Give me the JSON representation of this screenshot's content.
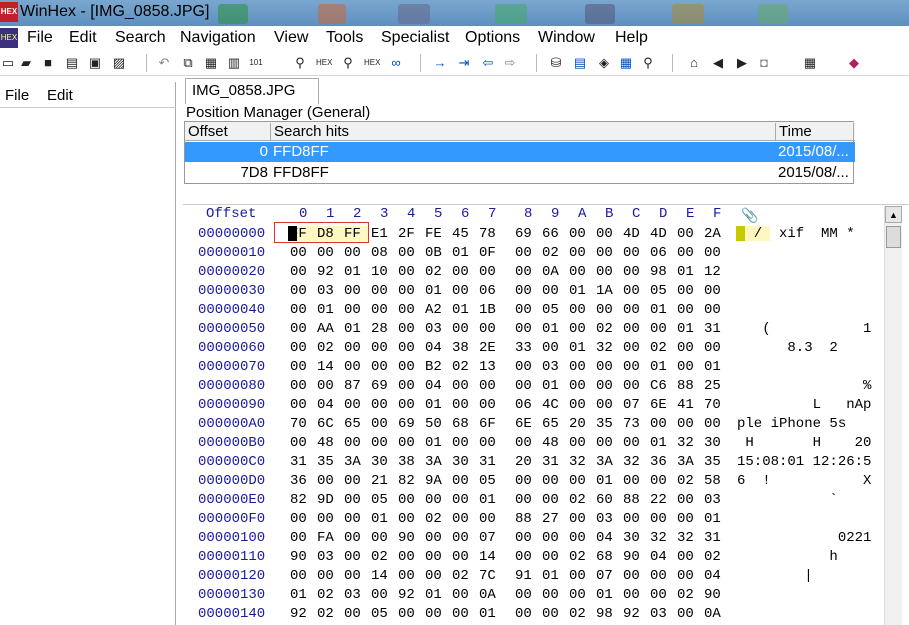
{
  "window": {
    "title": "WinHex - [IMG_0858.JPG]"
  },
  "menu": [
    "File",
    "Edit",
    "Search",
    "Navigation",
    "View",
    "Tools",
    "Specialist",
    "Options",
    "Window",
    "Help"
  ],
  "left_menu": [
    "File",
    "Edit"
  ],
  "tab": {
    "label": "IMG_0858.JPG"
  },
  "position_manager": {
    "title": "Position Manager (General)",
    "columns": [
      "Offset",
      "Search hits",
      "Time"
    ],
    "rows": [
      {
        "offset": "0",
        "hits": "FFD8FF",
        "time": "2015/08/..."
      },
      {
        "offset": "7D8",
        "hits": "FFD8FF",
        "time": "2015/08/..."
      }
    ]
  },
  "hex": {
    "offset_label": "Offset",
    "columns": [
      "0",
      "1",
      "2",
      "3",
      "4",
      "5",
      "6",
      "7",
      "8",
      "9",
      "A",
      "B",
      "C",
      "D",
      "E",
      "F"
    ],
    "rows": [
      {
        "off": "00000000",
        "bytes": [
          "FF",
          "D8",
          "FF",
          "E1",
          "2F",
          "FE",
          "45",
          "78",
          "69",
          "66",
          "00",
          "00",
          "4D",
          "4D",
          "00",
          "2A"
        ],
        "ascii": "  /  xif  MM *"
      },
      {
        "off": "00000010",
        "bytes": [
          "00",
          "00",
          "00",
          "08",
          "00",
          "0B",
          "01",
          "0F",
          "00",
          "02",
          "00",
          "00",
          "00",
          "06",
          "00",
          "00"
        ],
        "ascii": ""
      },
      {
        "off": "00000020",
        "bytes": [
          "00",
          "92",
          "01",
          "10",
          "00",
          "02",
          "00",
          "00",
          "00",
          "0A",
          "00",
          "00",
          "00",
          "98",
          "01",
          "12"
        ],
        "ascii": ""
      },
      {
        "off": "00000030",
        "bytes": [
          "00",
          "03",
          "00",
          "00",
          "00",
          "01",
          "00",
          "06",
          "00",
          "00",
          "01",
          "1A",
          "00",
          "05",
          "00",
          "00"
        ],
        "ascii": ""
      },
      {
        "off": "00000040",
        "bytes": [
          "00",
          "01",
          "00",
          "00",
          "00",
          "A2",
          "01",
          "1B",
          "00",
          "05",
          "00",
          "00",
          "00",
          "01",
          "00",
          "00"
        ],
        "ascii": ""
      },
      {
        "off": "00000050",
        "bytes": [
          "00",
          "AA",
          "01",
          "28",
          "00",
          "03",
          "00",
          "00",
          "00",
          "01",
          "00",
          "02",
          "00",
          "00",
          "01",
          "31"
        ],
        "ascii": "   (           1"
      },
      {
        "off": "00000060",
        "bytes": [
          "00",
          "02",
          "00",
          "00",
          "00",
          "04",
          "38",
          "2E",
          "33",
          "00",
          "01",
          "32",
          "00",
          "02",
          "00",
          "00"
        ],
        "ascii": "      8.3  2"
      },
      {
        "off": "00000070",
        "bytes": [
          "00",
          "14",
          "00",
          "00",
          "00",
          "B2",
          "02",
          "13",
          "00",
          "03",
          "00",
          "00",
          "00",
          "01",
          "00",
          "01"
        ],
        "ascii": ""
      },
      {
        "off": "00000080",
        "bytes": [
          "00",
          "00",
          "87",
          "69",
          "00",
          "04",
          "00",
          "00",
          "00",
          "01",
          "00",
          "00",
          "00",
          "C6",
          "88",
          "25"
        ],
        "ascii": "               %"
      },
      {
        "off": "00000090",
        "bytes": [
          "00",
          "04",
          "00",
          "00",
          "00",
          "01",
          "00",
          "00",
          "06",
          "4C",
          "00",
          "00",
          "07",
          "6E",
          "41",
          "70"
        ],
        "ascii": "         L   nAp"
      },
      {
        "off": "000000A0",
        "bytes": [
          "70",
          "6C",
          "65",
          "00",
          "69",
          "50",
          "68",
          "6F",
          "6E",
          "65",
          "20",
          "35",
          "73",
          "00",
          "00",
          "00"
        ],
        "ascii": "ple iPhone 5s"
      },
      {
        "off": "000000B0",
        "bytes": [
          "00",
          "48",
          "00",
          "00",
          "00",
          "01",
          "00",
          "00",
          "00",
          "48",
          "00",
          "00",
          "00",
          "01",
          "32",
          "30"
        ],
        "ascii": " H       H    20"
      },
      {
        "off": "000000C0",
        "bytes": [
          "31",
          "35",
          "3A",
          "30",
          "38",
          "3A",
          "30",
          "31",
          "20",
          "31",
          "32",
          "3A",
          "32",
          "36",
          "3A",
          "35"
        ],
        "ascii": "15:08:01 12:26:5"
      },
      {
        "off": "000000D0",
        "bytes": [
          "36",
          "00",
          "00",
          "21",
          "82",
          "9A",
          "00",
          "05",
          "00",
          "00",
          "00",
          "01",
          "00",
          "00",
          "02",
          "58"
        ],
        "ascii": "6  !           X"
      },
      {
        "off": "000000E0",
        "bytes": [
          "82",
          "9D",
          "00",
          "05",
          "00",
          "00",
          "00",
          "01",
          "00",
          "00",
          "02",
          "60",
          "88",
          "22",
          "00",
          "03"
        ],
        "ascii": "           `"
      },
      {
        "off": "000000F0",
        "bytes": [
          "00",
          "00",
          "00",
          "01",
          "00",
          "02",
          "00",
          "00",
          "88",
          "27",
          "00",
          "03",
          "00",
          "00",
          "00",
          "01"
        ],
        "ascii": ""
      },
      {
        "off": "00000100",
        "bytes": [
          "00",
          "FA",
          "00",
          "00",
          "90",
          "00",
          "00",
          "07",
          "00",
          "00",
          "00",
          "04",
          "30",
          "32",
          "32",
          "31"
        ],
        "ascii": "            0221"
      },
      {
        "off": "00000110",
        "bytes": [
          "90",
          "03",
          "00",
          "02",
          "00",
          "00",
          "00",
          "14",
          "00",
          "00",
          "02",
          "68",
          "90",
          "04",
          "00",
          "02"
        ],
        "ascii": "           h"
      },
      {
        "off": "00000120",
        "bytes": [
          "00",
          "00",
          "00",
          "14",
          "00",
          "00",
          "02",
          "7C",
          "91",
          "01",
          "00",
          "07",
          "00",
          "00",
          "00",
          "04"
        ],
        "ascii": "        |"
      },
      {
        "off": "00000130",
        "bytes": [
          "01",
          "02",
          "03",
          "00",
          "92",
          "01",
          "00",
          "0A",
          "00",
          "00",
          "00",
          "01",
          "00",
          "00",
          "02",
          "90"
        ],
        "ascii": ""
      },
      {
        "off": "00000140",
        "bytes": [
          "92",
          "02",
          "00",
          "05",
          "00",
          "00",
          "00",
          "01",
          "00",
          "00",
          "02",
          "98",
          "92",
          "03",
          "00",
          "0A"
        ],
        "ascii": ""
      }
    ]
  },
  "colors": {
    "selection": "#3399ff",
    "offset_text": "#1a1aa0",
    "highlight": "#fff7c0",
    "box": "#e03030"
  },
  "icons": [
    "new-file-icon",
    "open-folder-icon",
    "save-icon",
    "print-icon",
    "properties-icon",
    "open-disk-icon",
    "undo-icon",
    "copy-icon",
    "paste-icon",
    "clipboard-icon",
    "hex-icon",
    "find-text-icon",
    "replace-icon",
    "find-hex-icon",
    "binoculars-icon",
    "goto-offset-icon",
    "goto-sector-icon",
    "back-arrow-icon",
    "forward-arrow-icon",
    "disk-editor-icon",
    "ram-editor-icon",
    "drive-icon",
    "calculator-icon",
    "magnify-icon",
    "snapshot-icon",
    "prev-icon",
    "next-icon",
    "camera-icon",
    "table-icon",
    "book-icon"
  ]
}
